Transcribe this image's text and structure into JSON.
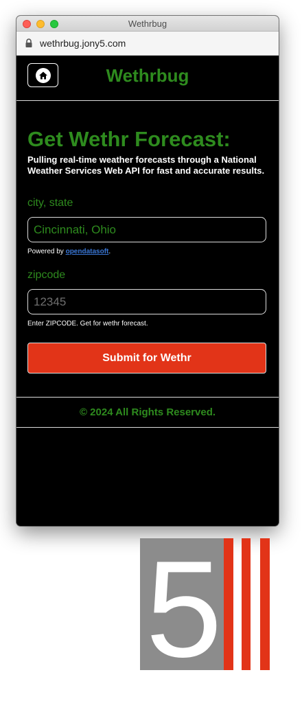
{
  "window": {
    "title": "Wethrbug"
  },
  "browser": {
    "url": "wethrbug.jony5.com"
  },
  "header": {
    "brand": "Wethrbug",
    "home_icon": "home-icon"
  },
  "main": {
    "heading": "Get Wethr Forecast:",
    "subtitle": "Pulling real-time weather forecasts through a National Weather Services Web API for fast and accurate results.",
    "city": {
      "label": "city, state",
      "value": "Cincinnati, Ohio",
      "hint_prefix": "Powered by ",
      "hint_link": "opendatasoft",
      "hint_suffix": "."
    },
    "zip": {
      "label": "zipcode",
      "placeholder": "12345",
      "hint": "Enter ZIPCODE. Get for wethr forecast."
    },
    "submit_label": "Submit for Wethr"
  },
  "footer": {
    "text": "© 2024 All Rights Reserved."
  },
  "logo": {
    "text": "5"
  },
  "colors": {
    "accent": "#2e8b1e",
    "button": "#e23418",
    "background": "#000000",
    "logo_gray": "#8c8c8c"
  }
}
